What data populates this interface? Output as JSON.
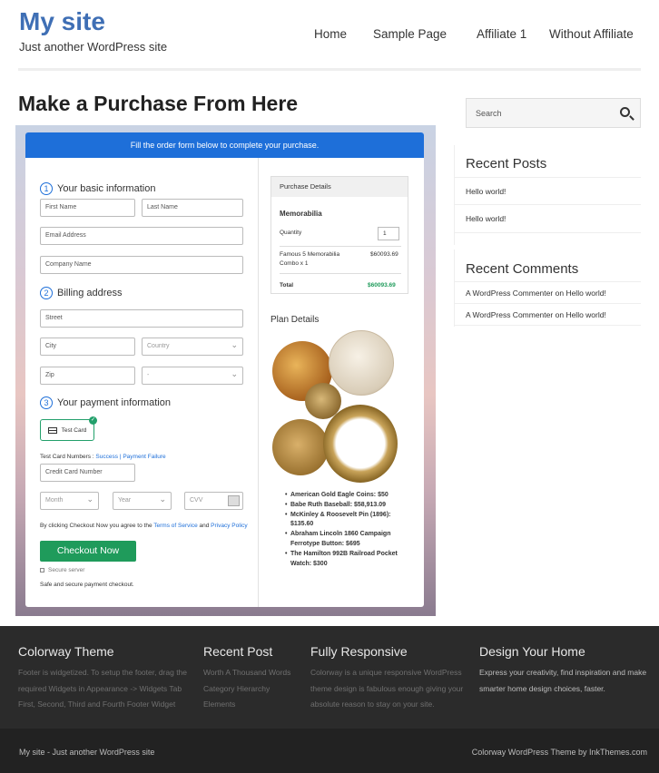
{
  "site": {
    "title": "My site",
    "tagline": "Just another WordPress site"
  },
  "nav": [
    "Home",
    "Sample Page",
    "Affiliate 1",
    "Without Affiliate"
  ],
  "page_title": "Make a Purchase From Here",
  "checkout": {
    "banner": "Fill the order form below to complete your purchase.",
    "step1": {
      "num": "1",
      "label": "Your basic information"
    },
    "step2": {
      "num": "2",
      "label": "Billing address"
    },
    "step3": {
      "num": "3",
      "label": "Your payment information"
    },
    "first_name": "First Name",
    "last_name": "Last Name",
    "email": "Email Address",
    "company": "Company Name",
    "street": "Street",
    "city": "City",
    "country": "Country",
    "zip": "Zip",
    "state": "-",
    "test_card": "Test Card",
    "test_numbers_label": "Test Card Numbers :",
    "success_link": "Success",
    "separator": "|",
    "failure_link": "Payment Failure",
    "credit_card": "Credit Card Number",
    "month": "Month",
    "year": "Year",
    "cvv": "CVV",
    "terms_prefix": "By clicking Checkout Now you agree to the",
    "terms_link": "Terms of Service",
    "and": "and",
    "privacy_link": "Privacy Policy",
    "checkout_button": "Checkout Now",
    "secure": "Secure server",
    "safe": "Safe and secure payment checkout."
  },
  "purchase": {
    "header": "Purchase Details",
    "product": "Memorabilia",
    "quantity_label": "Quantity",
    "quantity": "1",
    "item_name_1": "Famous 5 Memorabilia",
    "item_name_2": "Combo x 1",
    "item_price": "$60093.69",
    "total_label": "Total",
    "total": "$60093.69"
  },
  "plan": {
    "title": "Plan Details",
    "items": [
      "American Gold Eagle Coins: $50",
      "Babe Ruth Baseball: $58,913.09",
      "McKinley & Roosevelt Pin (1896): $135.60",
      "Abraham Lincoln 1860 Campaign Ferrotype Button: $695",
      "The Hamilton 992B Railroad Pocket Watch: $300"
    ]
  },
  "sidebar": {
    "search_placeholder": "Search",
    "recent_posts_title": "Recent Posts",
    "recent_posts": [
      "Hello world!",
      "Hello world!"
    ],
    "recent_comments_title": "Recent Comments",
    "recent_comments": [
      {
        "author": "A WordPress Commenter",
        "on": "on",
        "post": "Hello world!"
      },
      {
        "author": "A WordPress Commenter",
        "on": "on",
        "post": "Hello world!"
      }
    ]
  },
  "footer": {
    "col1_title": "Colorway Theme",
    "col1_text": "Footer is widgetized. To setup the footer, drag the required Widgets in Appearance -> Widgets Tab First, Second, Third and Fourth Footer Widget",
    "col2_title": "Recent Post",
    "col2_text": "Worth A Thousand Words Category Hierarchy Elements",
    "col3_title": "Fully Responsive",
    "col3_text": "Colorway is a unique responsive WordPress theme design is fabulous enough giving your absolute reason to stay on your site.",
    "col4_title": "Design Your Home",
    "col4_text": "Express your creativity, find inspiration and make smarter home design choices, faster.",
    "bottom_left": "My site - Just another WordPress site",
    "bottom_right": "Colorway WordPress Theme by InkThemes.com"
  },
  "colors": {
    "brand": "#3f6fb5",
    "banner": "#1e6fd9",
    "checkout_button": "#1f9b5b",
    "total": "#1f9b5b",
    "footer": "#2b2b2b"
  }
}
